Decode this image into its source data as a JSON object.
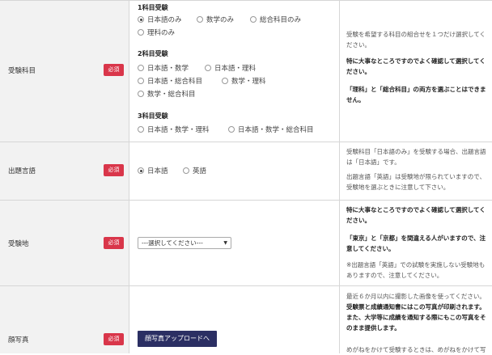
{
  "rows": {
    "subject": {
      "label": "受験科目",
      "required": "必須",
      "groups": [
        {
          "title": "1科目受験",
          "options": [
            "日本語のみ",
            "数学のみ",
            "総合科目のみ",
            "理科のみ"
          ],
          "selected": 0
        },
        {
          "title": "2科目受験",
          "options": [
            "日本語・数学",
            "日本語・理科",
            "日本語・総合科目",
            "数学・理科",
            "数学・総合科目"
          ]
        },
        {
          "title": "3科目受験",
          "options": [
            "日本語・数学・理科",
            "日本語・数学・総合科目"
          ]
        }
      ],
      "notes": [
        "受験を希望する科目の組合せを１つだけ選択してください。",
        "特に大事なところですのでよく確認して選択してください。",
        "「理科」と「総合科目」の両方を選ぶことはできません。"
      ]
    },
    "language": {
      "label": "出題言語",
      "required": "必須",
      "options": [
        "日本語",
        "英語"
      ],
      "selected": 0,
      "notes": [
        "受験科目「日本語のみ」を受験する場合、出題言語は「日本語」です。",
        "出題言語「英語」は受験地が限られていますので、受験地を選ぶときに注意して下さい。"
      ]
    },
    "venue": {
      "label": "受験地",
      "required": "必須",
      "select_value": "---選択してください---",
      "notes": [
        "特に大事なところですのでよく確認して選択してください。",
        "「東京」と「京都」を間違える人がいますので、注意してください。",
        "※出題言語「英語」での試験を実施しない受験地もありますので、注意してください。"
      ]
    },
    "photo": {
      "label": "顔写真",
      "required": "必須",
      "button": "顔写真アップロードへ",
      "notes": [
        "最近６か月以内に撮影した画像を使ってください。",
        "受験票と成績通知書にはこの写真が印刷されます。また、大学等に成績を通知する際にもこの写真をそのまま提供します。",
        "めがねをかけて受験するときは、めがねをかけて写"
      ]
    }
  }
}
